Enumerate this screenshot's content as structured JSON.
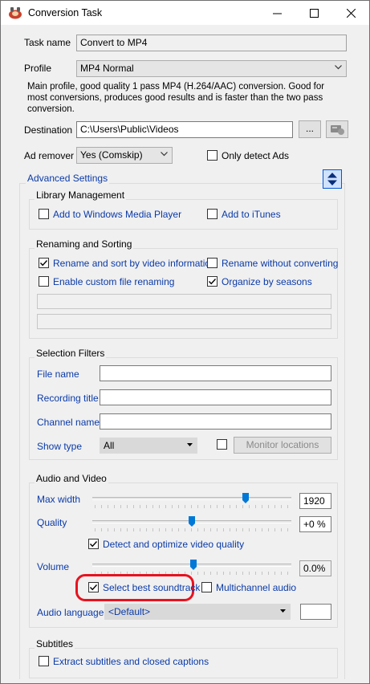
{
  "window": {
    "title": "Conversion Task"
  },
  "task_name": {
    "label": "Task name",
    "value": "Convert to MP4"
  },
  "profile": {
    "label": "Profile",
    "value": "MP4 Normal",
    "description": "Main profile, good quality 1 pass MP4 (H.264/AAC) conversion. Good for most conversions, produces good results and is faster than the two pass conversion."
  },
  "destination": {
    "label": "Destination",
    "value": "C:\\Users\\Public\\Videos",
    "browse_label": "..."
  },
  "ad_remover": {
    "label": "Ad remover",
    "value": "Yes (Comskip)",
    "only_detect_label": "Only detect Ads",
    "only_detect_checked": false
  },
  "advanced": {
    "label": "Advanced Settings"
  },
  "library": {
    "title": "Library Management",
    "wmp_label": "Add to Windows Media Player",
    "wmp_checked": false,
    "itunes_label": "Add to iTunes",
    "itunes_checked": false
  },
  "renaming": {
    "title": "Renaming and Sorting",
    "rename_sort_label": "Rename and sort by video information",
    "rename_sort_checked": true,
    "rename_noconv_label": "Rename without converting",
    "rename_noconv_checked": false,
    "custom_label": "Enable custom file renaming",
    "custom_checked": false,
    "seasons_label": "Organize by seasons",
    "seasons_checked": true
  },
  "filters": {
    "title": "Selection Filters",
    "file_name_label": "File name",
    "file_name_value": "",
    "recording_title_label": "Recording title",
    "recording_title_value": "",
    "channel_name_label": "Channel name",
    "channel_name_value": "",
    "show_type_label": "Show type",
    "show_type_value": "All",
    "monitor_locations_label": "Monitor locations",
    "monitor_checked": false
  },
  "audio_video": {
    "title": "Audio and Video",
    "max_width_label": "Max width",
    "max_width_value": "1920",
    "max_width_fraction": 0.77,
    "quality_label": "Quality",
    "quality_value": "+0 %",
    "quality_fraction": 0.5,
    "detect_label": "Detect and optimize video quality",
    "detect_checked": true,
    "volume_label": "Volume",
    "volume_value": "0.0%",
    "volume_fraction": 0.5,
    "best_soundtrack_label": "Select best soundtrack",
    "best_soundtrack_checked": true,
    "multichannel_label": "Multichannel audio",
    "multichannel_checked": false,
    "audio_language_label": "Audio language",
    "audio_language_value": "<Default>",
    "audio_language_extra": ""
  },
  "subtitles": {
    "title": "Subtitles",
    "extract_label": "Extract subtitles and closed captions",
    "extract_checked": false
  },
  "colors": {
    "accent": "#0a3aa8",
    "highlight": "#e8121f",
    "expand_button": "#0057d8"
  }
}
